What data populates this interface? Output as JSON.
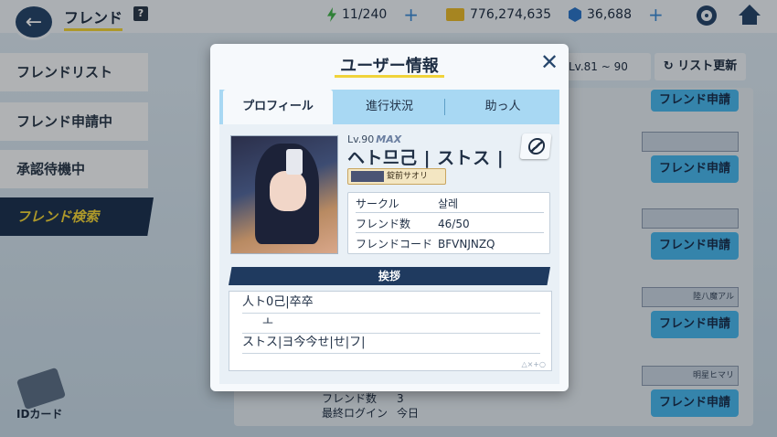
{
  "header": {
    "title": "フレンド",
    "help_label": "?",
    "ap": "11/240",
    "credits": "776,274,635",
    "gems": "36,688"
  },
  "sidebar": {
    "items": [
      {
        "label": "フレンドリスト"
      },
      {
        "label": "フレンド申請中"
      },
      {
        "label": "承認待機中"
      },
      {
        "label": "フレンド検索"
      }
    ],
    "id_card_label": "IDカード"
  },
  "toolbar": {
    "level_filter": "Lv.81 ~ 90",
    "refresh_label": "リスト更新"
  },
  "friend_list": {
    "request_label": "フレンド申請",
    "banners": [
      "",
      "",
      "陸八魔アル",
      "明星ヒマリ"
    ],
    "bottom_stat_labels": [
      "フレンド数",
      "最終ログイン"
    ],
    "bottom_stat_values": [
      "3",
      "今日"
    ]
  },
  "modal": {
    "title": "ユーザー情報",
    "close_icon": "close-icon",
    "tabs": [
      "プロフィール",
      "進行状況",
      "助っ人"
    ],
    "level": "Lv.90",
    "level_max": "MAX",
    "user_name": "ヘト므己 | ストス |",
    "title_badge": "錠前サオリ",
    "info": [
      {
        "label": "サークル",
        "value": "살레"
      },
      {
        "label": "フレンド数",
        "value": "46/50"
      },
      {
        "label": "フレンドコード",
        "value": "BFVNJNZQ"
      }
    ],
    "greeting_header": "挨拶",
    "greeting_lines": [
      "人ト0己|卒卒",
      "ㅗ",
      "ストス|ヨ今今せ|せ|フ|"
    ],
    "greeting_mark": "△×+○"
  }
}
